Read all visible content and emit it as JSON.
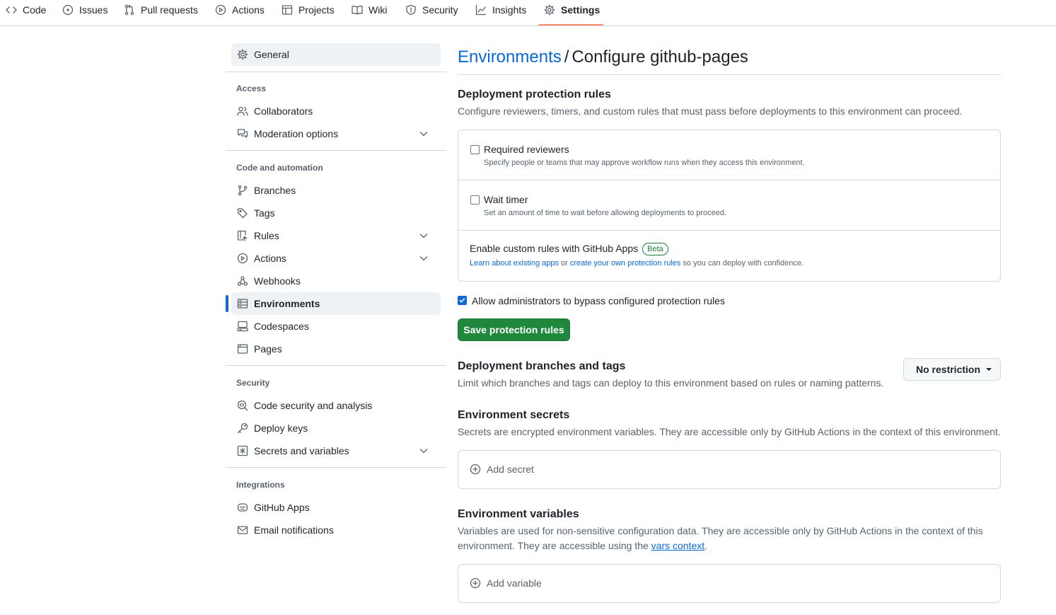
{
  "topnav": {
    "items": [
      {
        "label": "Code",
        "icon": "code-icon"
      },
      {
        "label": "Issues",
        "icon": "issue-opened-icon"
      },
      {
        "label": "Pull requests",
        "icon": "git-pull-request-icon"
      },
      {
        "label": "Actions",
        "icon": "play-icon"
      },
      {
        "label": "Projects",
        "icon": "table-icon"
      },
      {
        "label": "Wiki",
        "icon": "book-icon"
      },
      {
        "label": "Security",
        "icon": "shield-icon"
      },
      {
        "label": "Insights",
        "icon": "graph-icon"
      },
      {
        "label": "Settings",
        "icon": "gear-icon"
      }
    ],
    "active": "Settings"
  },
  "sidebar": {
    "general": "General",
    "access_heading": "Access",
    "collaborators": "Collaborators",
    "moderation": "Moderation options",
    "code_heading": "Code and automation",
    "branches": "Branches",
    "tags": "Tags",
    "rules": "Rules",
    "actions": "Actions",
    "webhooks": "Webhooks",
    "environments": "Environments",
    "codespaces": "Codespaces",
    "pages": "Pages",
    "security_heading": "Security",
    "code_security": "Code security and analysis",
    "deploy_keys": "Deploy keys",
    "secrets": "Secrets and variables",
    "integrations_heading": "Integrations",
    "github_apps": "GitHub Apps",
    "email_notifications": "Email notifications",
    "selected": "Environments"
  },
  "main": {
    "breadcrumb_link": "Environments",
    "breadcrumb_sep": "/",
    "breadcrumb_current": "Configure github-pages",
    "protection": {
      "title": "Deployment protection rules",
      "desc": "Configure reviewers, timers, and custom rules that must pass before deployments to this environment can proceed.",
      "required_reviewers": {
        "label": "Required reviewers",
        "desc": "Specify people or teams that may approve workflow runs when they access this environment.",
        "checked": false
      },
      "wait_timer": {
        "label": "Wait timer",
        "desc": "Set an amount of time to wait before allowing deployments to proceed.",
        "checked": false
      },
      "custom_rules": {
        "label": "Enable custom rules with GitHub Apps",
        "badge": "Beta",
        "link1": "Learn about existing apps",
        "or": " or ",
        "link2": "create your own protection rules",
        "tail": " so you can deploy with confidence."
      },
      "bypass": {
        "label": "Allow administrators to bypass configured protection rules",
        "checked": true
      },
      "save_button": "Save protection rules"
    },
    "branches": {
      "title": "Deployment branches and tags",
      "desc": "Limit which branches and tags can deploy to this environment based on rules or naming patterns.",
      "select_value": "No restriction"
    },
    "secrets": {
      "title": "Environment secrets",
      "desc": "Secrets are encrypted environment variables. They are accessible only by GitHub Actions in the context of this environment.",
      "add_button": "Add secret"
    },
    "variables": {
      "title": "Environment variables",
      "desc_part1": "Variables are used for non-sensitive configuration data. They are accessible only by GitHub Actions in the context of this environment. They are accessible using the ",
      "desc_link": "vars context",
      "desc_part2": ".",
      "add_button": "Add variable"
    }
  },
  "colors": {
    "accent": "#0969da",
    "primary_button": "#1f883d",
    "nav_underline": "#fd8c73",
    "border": "#d1d9e0",
    "muted_text": "#59636e"
  }
}
